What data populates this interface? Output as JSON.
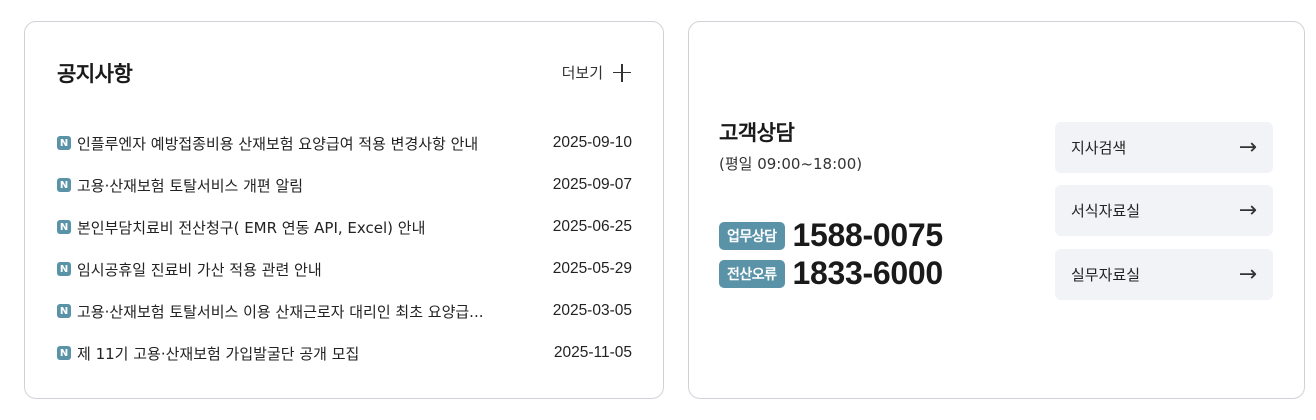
{
  "notice": {
    "title": "공지사항",
    "more_label": "더보기",
    "badge": "N",
    "items": [
      {
        "text": "인플루엔자 예방접종비용 산재보험 요양급여 적용 변경사항 안내",
        "date": "2025-09-10"
      },
      {
        "text": "고용·산재보험 토탈서비스 개편 알림",
        "date": "2025-09-07"
      },
      {
        "text": "본인부담치료비 전산청구( EMR 연동 API, Excel) 안내",
        "date": "2025-06-25"
      },
      {
        "text": "임시공휴일 진료비 가산 적용 관련 안내",
        "date": "2025-05-29"
      },
      {
        "text": "고용·산재보험 토탈서비스 이용 산재근로자 대리인 최초 요양급...",
        "date": "2025-03-05"
      },
      {
        "text": "제 11기 고용·산재보험 가입발굴단 공개 모집",
        "date": "2025-11-05"
      }
    ]
  },
  "contact": {
    "title": "고객상담",
    "hours": "(평일 09:00~18:00)",
    "phones": [
      {
        "label": "업무상담",
        "number": "1588-0075"
      },
      {
        "label": "전산오류",
        "number": "1833-6000"
      }
    ],
    "quick_links": [
      {
        "label": "지사검색",
        "icon": "arrow-right-icon"
      },
      {
        "label": "서식자료실",
        "icon": "arrow-right-icon"
      },
      {
        "label": "실무자료실",
        "icon": "arrow-right-icon"
      }
    ]
  },
  "colors": {
    "accent": "#5a93a8",
    "border": "#cfd3d8",
    "button_bg": "#f1f3f6"
  }
}
